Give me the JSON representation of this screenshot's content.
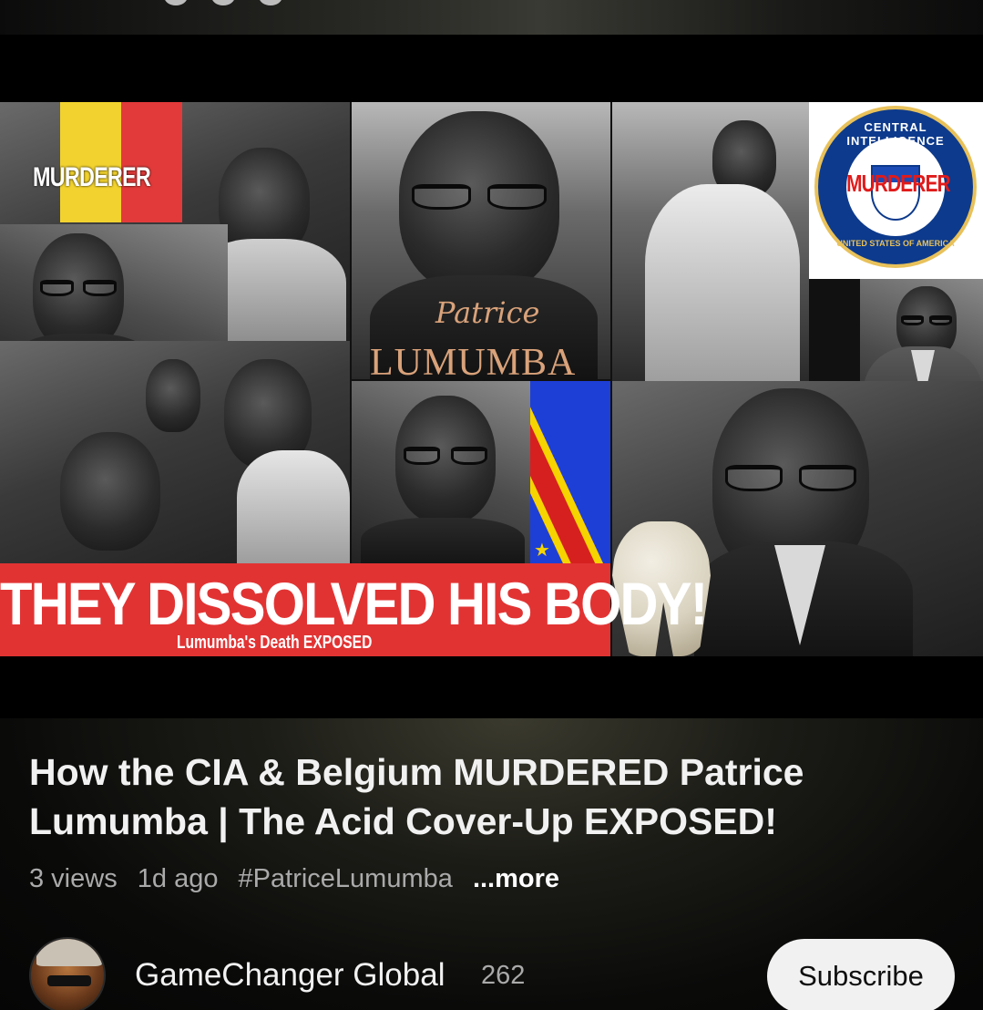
{
  "thumbnail": {
    "headline": "THEY DISSOLVED HIS BODY!",
    "subline": "Lumumba's Death EXPOSED",
    "flag_label": "MURDERER",
    "seal_top_text": "CENTRAL INTELLIGENCE AGENCY",
    "seal_bottom_text": "UNITED STATES OF AMERICA",
    "seal_stamp": "MURDERER",
    "poster_script": "Patrice",
    "poster_name": "LUMUMBA",
    "colors": {
      "banner_red": "#e23333",
      "drc_blue": "#1e3fd6",
      "flag_gold": "#f5d400"
    }
  },
  "video": {
    "title": "How the CIA & Belgium MURDERED Patrice Lumumba | The Acid Cover-Up EXPOSED!",
    "views": "3 views",
    "age": "1d ago",
    "hashtag": "#PatriceLumumba",
    "more_label": "...more"
  },
  "channel": {
    "name": "GameChanger Global",
    "subscribers": "262",
    "subscribe_label": "Subscribe"
  }
}
